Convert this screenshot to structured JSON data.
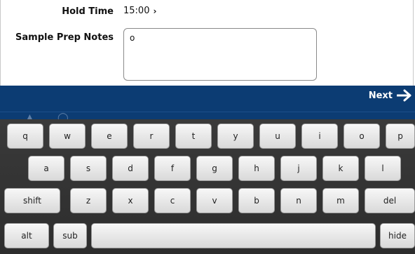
{
  "form": {
    "hold_time_label": "Hold Time",
    "hold_time_value": "15:00",
    "sample_prep_label": "Sample Prep Notes",
    "sample_prep_value": "o"
  },
  "nav": {
    "next_label": "Next"
  },
  "keyboard": {
    "row1": [
      "q",
      "w",
      "e",
      "r",
      "t",
      "y",
      "u",
      "i",
      "o",
      "p"
    ],
    "row2": [
      "a",
      "s",
      "d",
      "f",
      "g",
      "h",
      "j",
      "k",
      "l"
    ],
    "row3": [
      "shift",
      "z",
      "x",
      "c",
      "v",
      "b",
      "n",
      "m",
      "del"
    ],
    "row4": {
      "alt": "alt",
      "sub": "sub",
      "space": "",
      "hide": "hide"
    }
  },
  "colors": {
    "nav_bar": "#0c3c73",
    "keyboard_bg": "#333333",
    "key_face": "#eeeeee"
  }
}
